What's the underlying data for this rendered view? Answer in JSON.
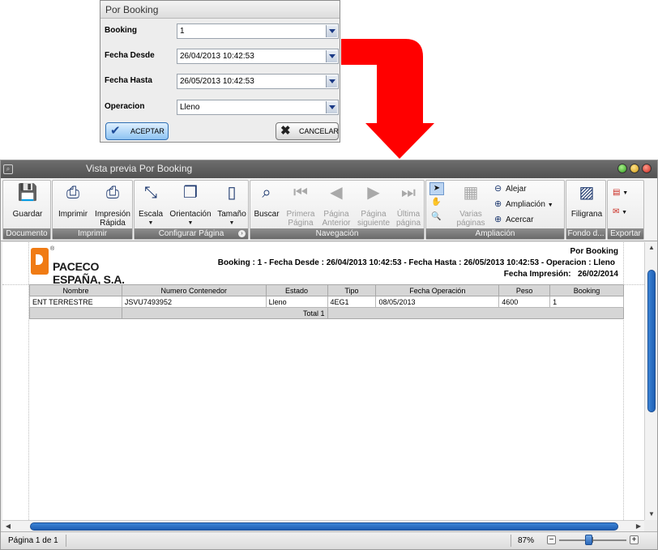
{
  "dialog": {
    "title": "Por Booking",
    "fields": [
      {
        "label": "Booking",
        "value": "1"
      },
      {
        "label": "Fecha Desde",
        "value": "26/04/2013 10:42:53"
      },
      {
        "label": "Fecha Hasta",
        "value": "26/05/2013 10:42:53"
      },
      {
        "label": "Operacion",
        "value": "Lleno"
      }
    ],
    "accept_label": "ACEPTAR",
    "cancel_label": "CANCELAR"
  },
  "arrow_color": "#ff0000",
  "window": {
    "title": "Vista previa Por Booking"
  },
  "ribbon": {
    "groups": {
      "documento": "Documento",
      "imprimir": "Imprimir",
      "configurar": "Configurar Página",
      "navegacion": "Navegación",
      "ampliacion": "Ampliación",
      "fondo": "Fondo d...",
      "exportar": "Exportar"
    },
    "buttons": {
      "guardar": "Guardar",
      "imprimir": "Imprimir",
      "impresion_rapida_1": "Impresión",
      "impresion_rapida_2": "Rápida",
      "escala": "Escala",
      "orientacion": "Orientación",
      "tamano": "Tamaño",
      "buscar": "Buscar",
      "primera_1": "Primera",
      "primera_2": "Página",
      "anterior_1": "Página",
      "anterior_2": "Anterior",
      "siguiente_1": "Página",
      "siguiente_2": "siguiente",
      "ultima_1": "Última",
      "ultima_2": "página",
      "varias_1": "Varias",
      "varias_2": "páginas",
      "alejar": "Alejar",
      "ampliacion": "Ampliación",
      "acercar": "Acercar",
      "filigrana": "Filigrana"
    }
  },
  "report": {
    "company": "PACECO ESPAÑA, S.A.",
    "title": "Por Booking",
    "filters": "Booking : 1 - Fecha Desde : 26/04/2013 10:42:53 - Fecha Hasta : 26/05/2013 10:42:53 - Operacion : Lleno",
    "print_date_label": "Fecha Impresión:",
    "print_date": "26/02/2014",
    "columns": [
      "Nombre",
      "Numero Contenedor",
      "Estado",
      "Tipo",
      "Fecha Operación",
      "Peso",
      "Booking"
    ],
    "rows": [
      [
        "ENT TERRESTRE",
        "JSVU7493952",
        "Lleno",
        "4EG1",
        "08/05/2013",
        "4600",
        "1"
      ]
    ],
    "total_label": "Total 1"
  },
  "status": {
    "page": "Página 1 de 1",
    "zoom": "87%"
  }
}
